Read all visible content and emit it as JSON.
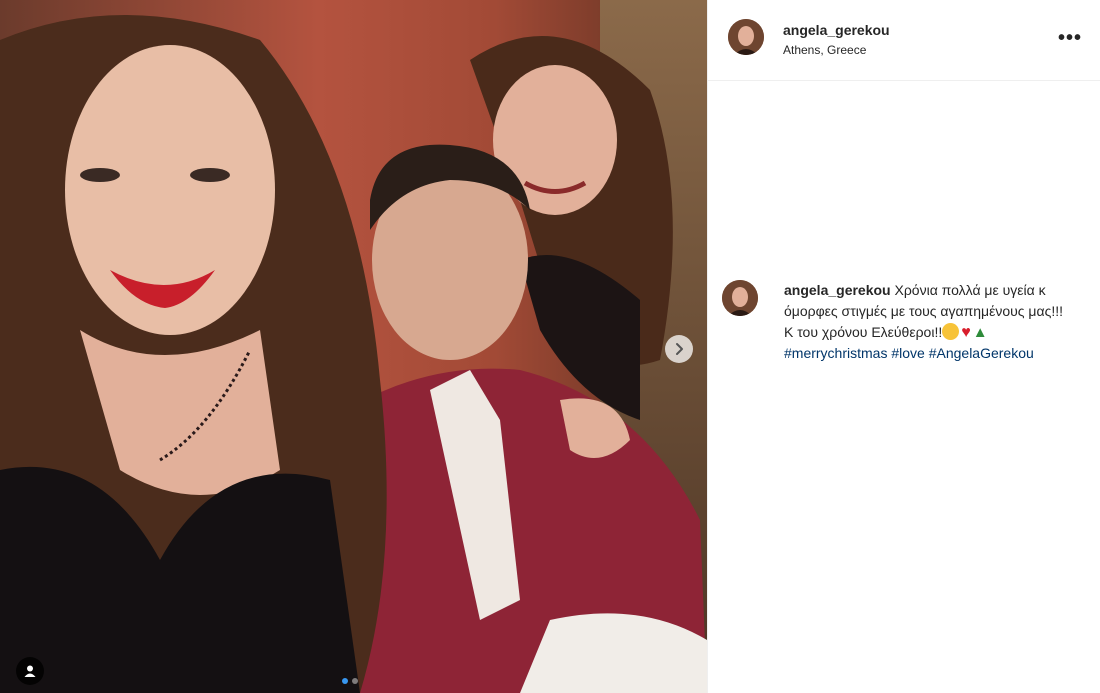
{
  "post": {
    "username": "angela_gerekou",
    "location": "Athens, Greece",
    "more_label": "•••",
    "carousel": {
      "slide_count": 2,
      "active_index": 0
    }
  },
  "caption": {
    "username": "angela_gerekou",
    "text": "Χρόνια πολλά με υγεία κ όμορφες στιγμές με τους αγαπημένους μας!!! Κ του χρόνου Ελεύθεροι!!",
    "emojis": [
      "grinning-emoji",
      "heart-emoji",
      "christmas-tree-emoji"
    ],
    "hashtags": [
      "#merrychristmas",
      "#love",
      "#AngelaGerekou"
    ]
  },
  "colors": {
    "link": "#003569",
    "text": "#262626",
    "carousel_active": "#3897f0"
  }
}
